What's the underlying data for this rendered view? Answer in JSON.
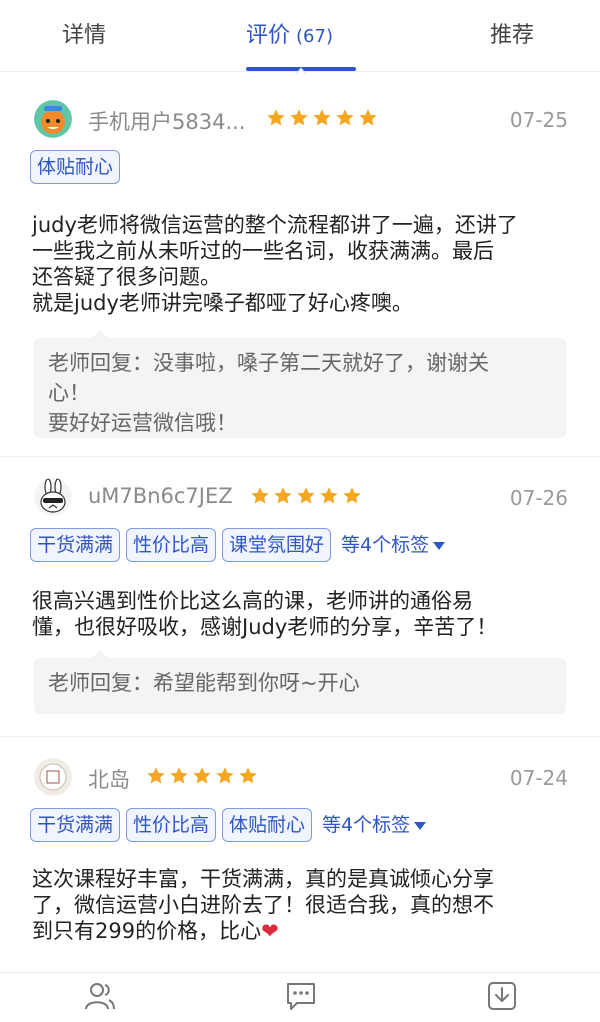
{
  "tabs": {
    "details": "详情",
    "reviews": "评价",
    "reviews_count": "(67)",
    "recommend": "推荐"
  },
  "reviews": [
    {
      "user": "手机用户5834...",
      "date": "07-25",
      "rating": 5,
      "tags": [
        "体贴耐心"
      ],
      "more_tags": "",
      "content_lines": [
        "judy老师将微信运营的整个流程都讲了一遍，还讲了",
        "一些我之前从未听过的一些名词，收获满满。最后",
        "还答疑了很多问题。",
        "就是judy老师讲完嗓子都哑了好心疼噢。"
      ],
      "reply_lines": [
        "老师回复：没事啦，嗓子第二天就好了，谢谢关",
        "心！",
        "要好好运营微信哦！"
      ]
    },
    {
      "user": "uM7Bn6c7JEZ",
      "date": "07-26",
      "rating": 5,
      "tags": [
        "干货满满",
        "性价比高",
        "课堂氛围好"
      ],
      "more_tags": "等4个标签",
      "content_lines": [
        "很高兴遇到性价比这么高的课，老师讲的通俗易",
        "懂，也很好吸收，感谢Judy老师的分享，辛苦了！"
      ],
      "reply_lines": [
        "老师回复：希望能帮到你呀~开心"
      ]
    },
    {
      "user": "北岛",
      "date": "07-24",
      "rating": 5,
      "tags": [
        "干货满满",
        "性价比高",
        "体贴耐心"
      ],
      "more_tags": "等4个标签",
      "content_lines": [
        "这次课程好丰富，干货满满，真的是真诚倾心分享",
        "了，微信运营小白进阶去了！很适合我，真的想不",
        "到只有299的价格，比心"
      ],
      "reply_lines": []
    }
  ],
  "colors": {
    "accent": "#2f56c7",
    "star": "#f5a623",
    "heart": "#e02a3c"
  },
  "icons": {
    "nav_1": "users-icon",
    "nav_2": "chat-icon",
    "nav_3": "download-icon"
  }
}
